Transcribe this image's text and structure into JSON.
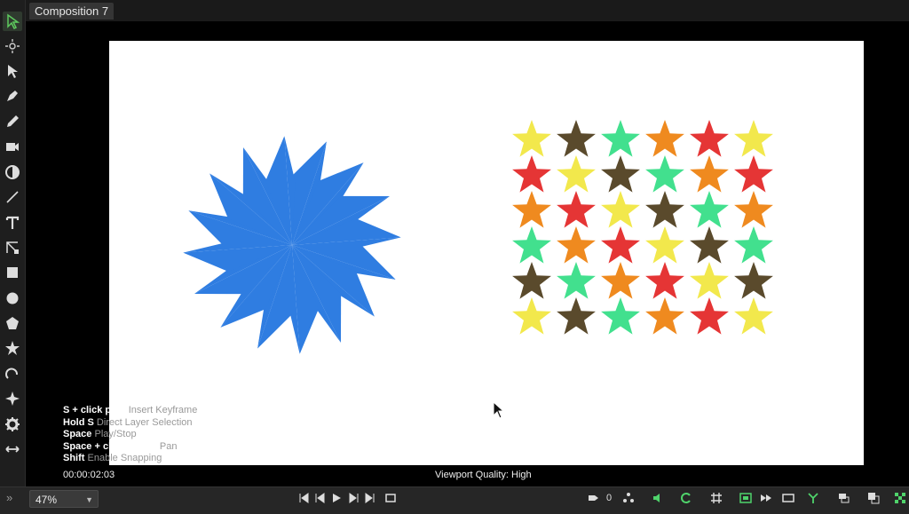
{
  "composition": {
    "tab_title": "Composition 7"
  },
  "toolbar": {
    "tools": [
      {
        "icon": "selection-arrow-icon",
        "active": true
      },
      {
        "icon": "move-anchor-icon"
      },
      {
        "icon": "direct-select-arrow-icon"
      },
      {
        "icon": "pen-icon"
      },
      {
        "icon": "pencil-icon"
      },
      {
        "icon": "camera-icon"
      },
      {
        "icon": "orbit-icon"
      },
      {
        "icon": "line-icon"
      },
      {
        "icon": "text-icon"
      },
      {
        "icon": "transform-icon"
      },
      {
        "icon": "rectangle-icon"
      },
      {
        "icon": "ellipse-icon"
      },
      {
        "icon": "pentagon-icon"
      },
      {
        "icon": "star-icon"
      },
      {
        "icon": "curve-icon"
      },
      {
        "icon": "sparkle-icon"
      },
      {
        "icon": "gear-icon"
      },
      {
        "icon": "width-icon"
      }
    ]
  },
  "hints": [
    {
      "key": "S + click path",
      "desc": "Insert Keyframe"
    },
    {
      "key": "Hold S",
      "desc": "Direct Layer Selection"
    },
    {
      "key": "Space",
      "desc": "Play/Stop"
    },
    {
      "key": "Space + click + drag",
      "desc": "Pan"
    },
    {
      "key": "Shift",
      "desc": "Enable Snapping"
    }
  ],
  "status": {
    "timecode": "00:00:02:03",
    "quality": "Viewport Quality: High"
  },
  "bottombar": {
    "zoom": "47%",
    "counter": "0"
  },
  "artwork": {
    "starburst_color": "#2f7de1",
    "star_palette": {
      "Y": "#f2e84c",
      "B": "#5a4a2c",
      "G": "#42e08e",
      "O": "#ef8a1f",
      "R": "#e53535"
    },
    "star_rows": [
      "YBGORY",
      "RYBGOR",
      "ORYBGO",
      "GORYBG",
      "BGORYB",
      "YBGORY"
    ]
  }
}
